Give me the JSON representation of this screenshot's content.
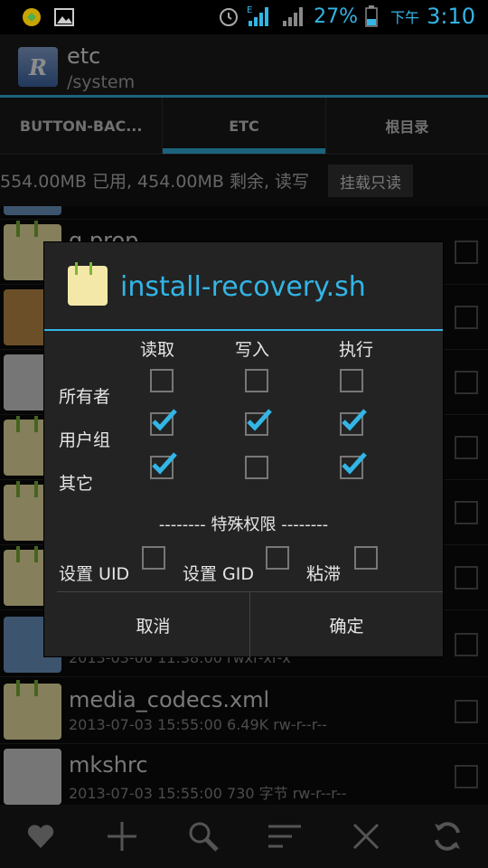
{
  "status_bar": {
    "battery": "27%",
    "ampm": "下午",
    "time": "3:10",
    "icons": [
      "app-notification-icon",
      "image-notification-icon",
      "alarm-icon",
      "signal-icon",
      "battery-icon"
    ]
  },
  "action_bar": {
    "title": "etc",
    "subtitle": "/system",
    "app_icon_letter": "R"
  },
  "tabs": [
    {
      "label": "BUTTON-BAC..."
    },
    {
      "label": "ETC",
      "active": true
    },
    {
      "label": "根目录"
    }
  ],
  "info_bar": {
    "text": "554.00MB 已用, 454.00MB 剩余, 读写",
    "mount_button": "挂载只读"
  },
  "files": [
    {
      "name": "",
      "meta": "",
      "icon": "folder"
    },
    {
      "name": "g.prop",
      "meta": "",
      "icon": "note"
    },
    {
      "name": "",
      "meta": "",
      "icon": "box"
    },
    {
      "name": "",
      "meta": "",
      "icon": "gear"
    },
    {
      "name": "",
      "meta": "",
      "icon": "note"
    },
    {
      "name": "",
      "meta": "",
      "icon": "note"
    },
    {
      "name": "",
      "meta": "",
      "icon": "note"
    },
    {
      "name": "",
      "meta": "2013-03-06 11:38:00  rwxr-xr-x",
      "icon": "folder"
    },
    {
      "name": "media_codecs.xml",
      "meta": "2013-07-03 15:55:00  6.49K  rw-r--r--",
      "icon": "note"
    },
    {
      "name": "mkshrc",
      "meta": "2013-07-03 15:55:00  730 字节  rw-r--r--",
      "icon": "gear"
    }
  ],
  "bottom_toolbar": [
    "favorite-icon",
    "add-icon",
    "search-icon",
    "sort-icon",
    "close-icon",
    "refresh-icon"
  ],
  "dialog": {
    "title": "install-recovery.sh",
    "columns": [
      "读取",
      "写入",
      "执行"
    ],
    "rows": [
      {
        "label": "所有者",
        "checks": [
          false,
          false,
          false
        ]
      },
      {
        "label": "用户组",
        "checks": [
          true,
          true,
          true
        ]
      },
      {
        "label": "其它",
        "checks": [
          true,
          false,
          true
        ]
      }
    ],
    "special_header": "-------- 特殊权限 --------",
    "special": [
      {
        "label": "设置 UID",
        "checked": false
      },
      {
        "label": "设置 GID",
        "checked": false
      },
      {
        "label": "粘滞",
        "checked": false
      }
    ],
    "cancel": "取消",
    "ok": "确定"
  },
  "colors": {
    "accent": "#33b5e5",
    "background": "#0c0c0c",
    "dialog": "#232323"
  }
}
